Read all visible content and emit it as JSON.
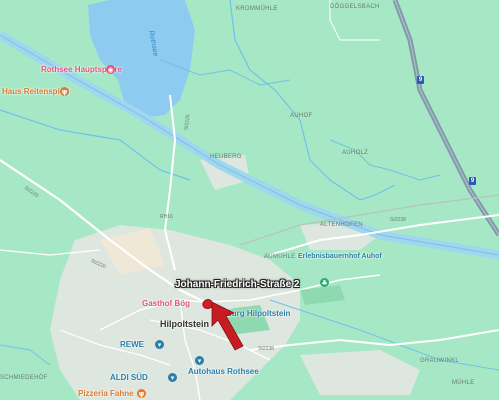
{
  "map": {
    "address_label": "Johann-Friedrich-Straße 2",
    "colors": {
      "land": "#a6e8c6",
      "water": "#8dcbf0",
      "urban": "#dde6df",
      "canal": "#9fd6f0",
      "highway": "#7f97a8",
      "pin": "#d22027"
    },
    "places": {
      "lake": "Rothsee",
      "lake_pump": "Rothsee Hauptsperre",
      "restaurant_reitenspiess": "Haus Reitenspieß",
      "gasthof": "Gasthof Bög",
      "burg": "Burg Hilpoltstein",
      "town": "Hilpoltstein",
      "rewe": "REWE",
      "aldi": "ALDI SÜD",
      "autohaus": "Autohaus Rothsee",
      "pizzeria": "Pizzeria Fahne",
      "erlebnishof": "Erlebnisbauernhof Auhof"
    },
    "localities": {
      "krommuehle": "KROMMÜHLE",
      "doggelsbach": "DÖGGELSBACH",
      "auhof": "AUHOF",
      "heuberg": "HEUBERG",
      "auholz": "AUHOLZ",
      "altenhofen": "ALTENHOFEN",
      "aumuehle": "AUMÜHLE",
      "grauweg": "GRAUWINKL",
      "muehle": "MÜHLE",
      "schlemm": "SCHMIEDEHÖF"
    },
    "roads": {
      "st2225": "St2225",
      "st2238a": "St2238",
      "st2238b": "St2238",
      "st2220": "St2220",
      "kr": "RH16"
    },
    "motorway_shield": "9",
    "icons": {
      "attraction": "camera-icon",
      "restaurant": "fork-knife-icon",
      "shop": "cart-icon",
      "park": "tree-icon",
      "hotel": "bed-icon"
    }
  }
}
